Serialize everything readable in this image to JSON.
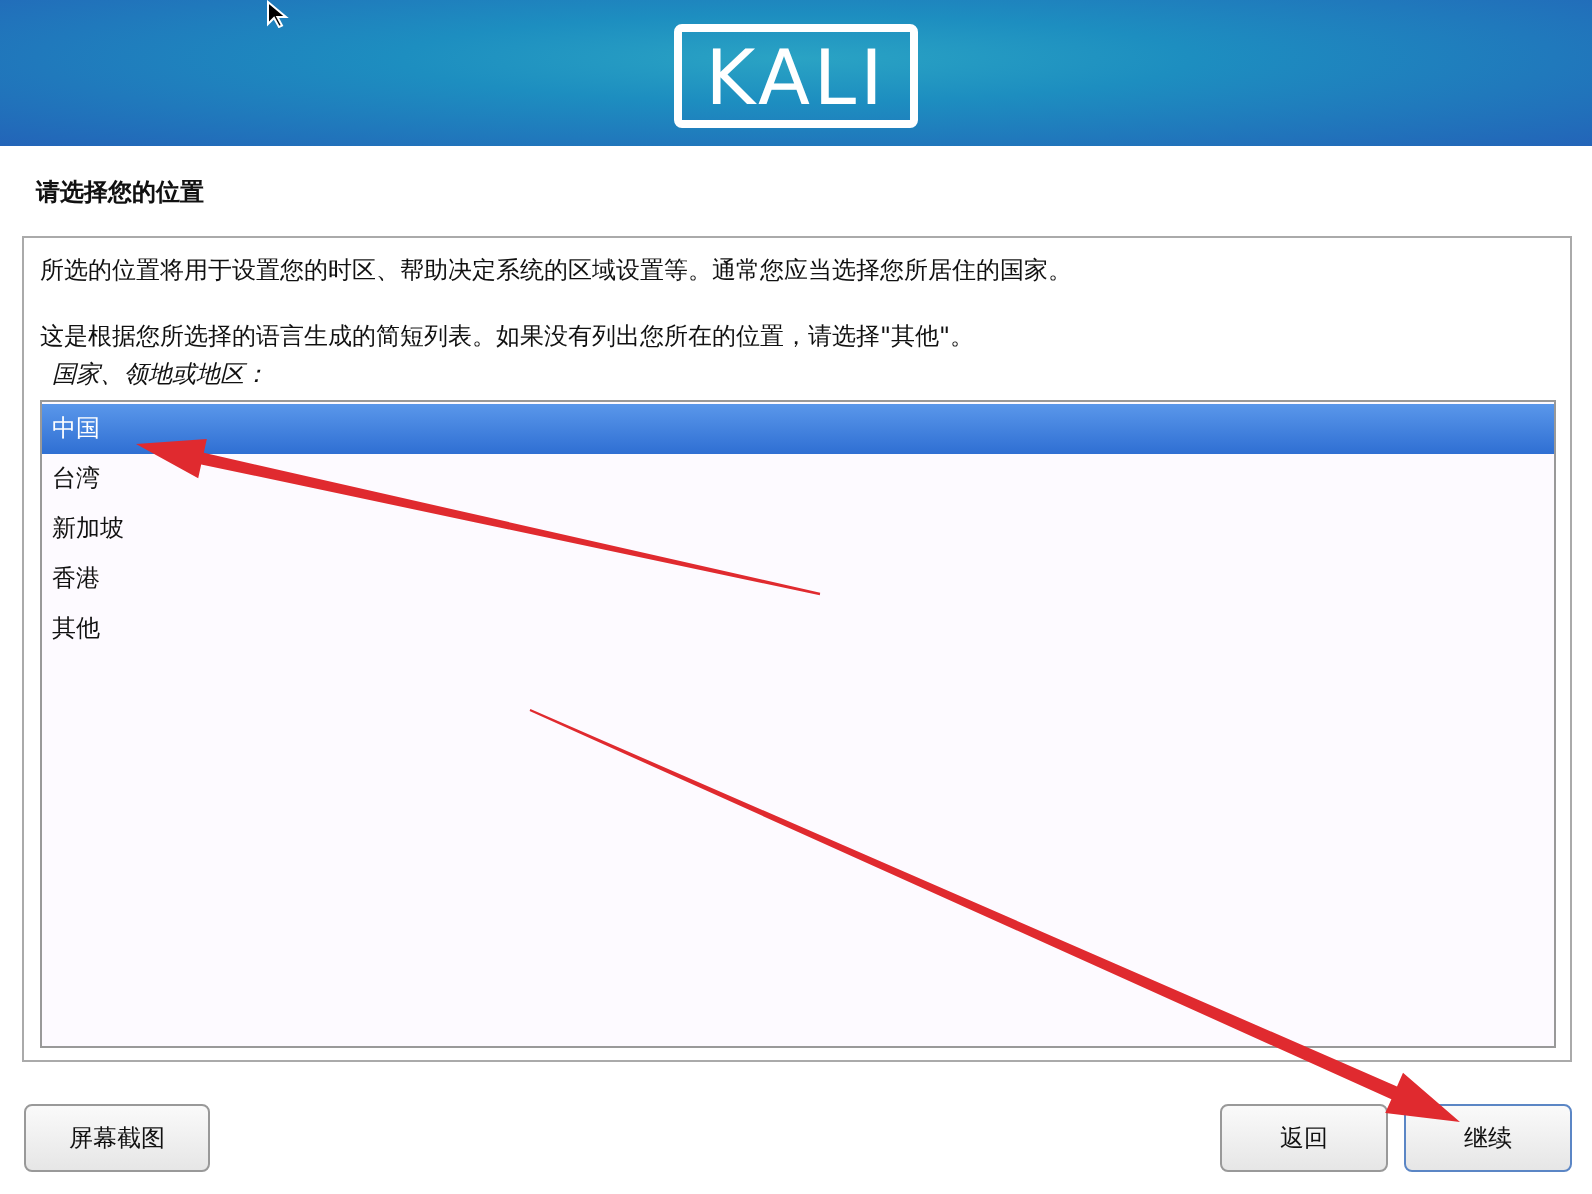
{
  "header": {
    "logo": "KALI"
  },
  "page_title": "请选择您的位置",
  "description": [
    "所选的位置将用于设置您的时区、帮助决定系统的区域设置等。通常您应当选择您所居住的国家。",
    "这是根据您所选择的语言生成的简短列表。如果没有列出您所在的位置，请选择\"其他\"。"
  ],
  "list_label": "国家、领地或地区：",
  "locations": [
    {
      "label": "中国",
      "selected": true
    },
    {
      "label": "台湾",
      "selected": false
    },
    {
      "label": "新加坡",
      "selected": false
    },
    {
      "label": "香港",
      "selected": false
    },
    {
      "label": "其他",
      "selected": false
    }
  ],
  "buttons": {
    "screenshot": "屏幕截图",
    "back": "返回",
    "continue": "继续"
  }
}
